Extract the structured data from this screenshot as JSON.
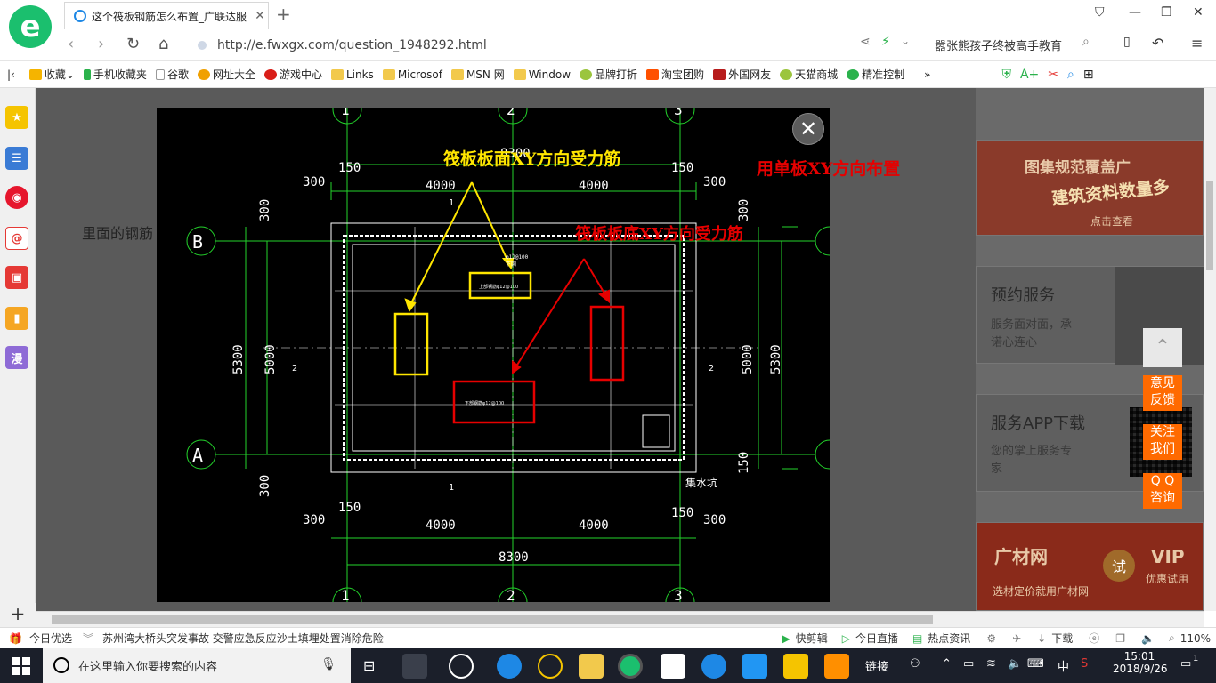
{
  "browser": {
    "tab_title": "这个筏板钢筋怎么布置_广联达服",
    "url": "http://e.fwxgx.com/question_1948292.html",
    "news_ad": "嚣张熊孩子终被高手教育"
  },
  "bookmarks": [
    "收藏",
    "手机收藏夹",
    "谷歌",
    "网址大全",
    "游戏中心",
    "Links",
    "Microsof",
    "MSN 网",
    "Window",
    "品牌打折",
    "淘宝团购",
    "外国网友",
    "天猫商城",
    "精准控制"
  ],
  "page": {
    "body_text": "里面的钢筋",
    "annotation_red_right": "用单板XY方向布置"
  },
  "drawing": {
    "label_top": "筏板板面XY方向受力筋",
    "label_bottom": "筏板板底XY方向受力筋",
    "grid_B": "B",
    "grid_A": "A",
    "grid_1": "1",
    "grid_2": "2",
    "grid_3": "3",
    "dim_8300_top": "8300",
    "dim_8300_bottom": "8300",
    "dim_4000_a": "4000",
    "dim_4000_b": "4000",
    "dim_4000_c": "4000",
    "dim_4000_d": "4000",
    "dim_150": "150",
    "dim_300": "300",
    "dim_5300": "5300",
    "dim_5000": "5000",
    "pit_label": "集水坑",
    "rebar_note": "φ12@100",
    "rebar_note2": "下网",
    "section_1": "1",
    "section_2": "2"
  },
  "sidebar_right": {
    "banner1_a": "图集规范覆盖广",
    "banner1_b": "建筑资料数量多",
    "banner1_c": "点击查看",
    "service_title": "预约服务",
    "service_desc1": "服务面对面，承",
    "service_desc2": "诺心连心",
    "app_title": "服务APP下载",
    "app_desc1": "您的掌上服务专",
    "app_desc2": "家",
    "ad_brand": "广材网",
    "ad_vip": "VIP",
    "ad_vip2": "优惠试用",
    "ad_tag": "试",
    "ad_desc": "选材定价就用广材网"
  },
  "float_buttons": [
    "意见\n反馈",
    "关注\n我们",
    "Q Q\n咨询"
  ],
  "statusbar": {
    "today": "今日优选",
    "news": "苏州湾大桥头突发事故 交警应急反应沙土填埋处置消除危险",
    "items": [
      "快剪辑",
      "今日直播",
      "热点资讯",
      "下载"
    ],
    "zoom": "110%"
  },
  "taskbar": {
    "search_placeholder": "在这里输入你要搜索的内容",
    "link_label": "链接",
    "ime": "中",
    "time": "15:01",
    "date": "2018/9/26",
    "notif_count": "1"
  }
}
